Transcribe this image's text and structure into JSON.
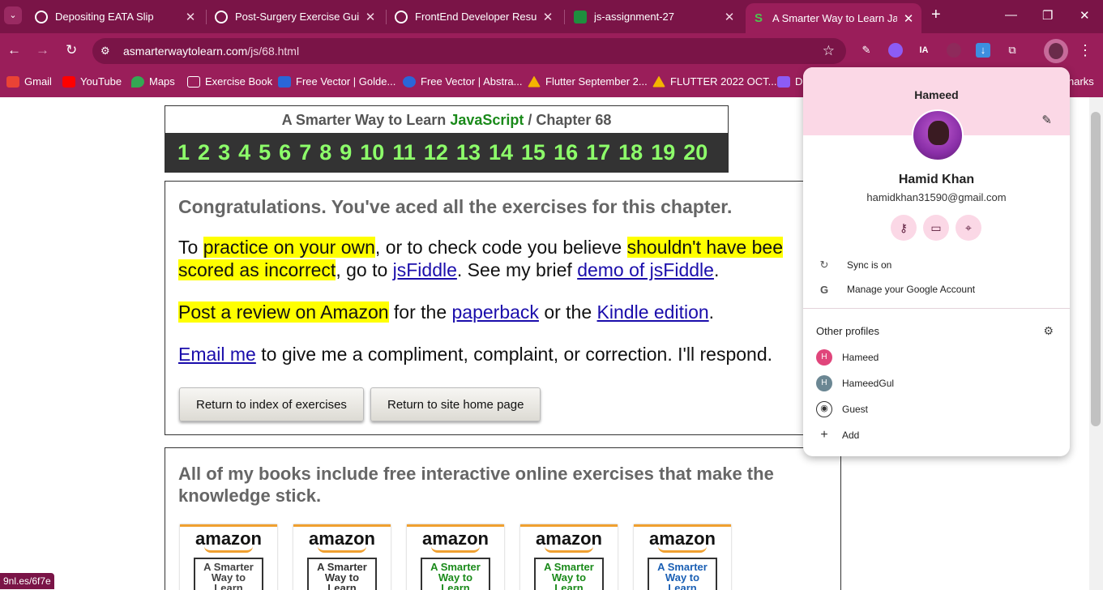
{
  "tabs": [
    {
      "title": "Depositing EATA Slip",
      "icon": "chatgpt-icon"
    },
    {
      "title": "Post-Surgery Exercise Guide",
      "icon": "chatgpt-icon"
    },
    {
      "title": "FrontEnd Developer Resume",
      "icon": "chatgpt-icon"
    },
    {
      "title": "js-assignment-27",
      "icon": "classroom-icon"
    },
    {
      "title": "A Smarter Way to Learn Java",
      "icon": "smarter-way-icon"
    }
  ],
  "window_controls": {
    "new_tab": "+",
    "minimize": "—",
    "restore": "❐",
    "close": "✕"
  },
  "omnibox": {
    "url_host": "asmarterwaytolearn.com",
    "url_path": "/js/68.html"
  },
  "bookmarks": [
    {
      "label": "Gmail"
    },
    {
      "label": "YouTube"
    },
    {
      "label": "Maps"
    },
    {
      "label": "Exercise Book"
    },
    {
      "label": "Free Vector | Golde..."
    },
    {
      "label": "Free Vector | Abstra..."
    },
    {
      "label": "Flutter September 2..."
    },
    {
      "label": "FLUTTER 2022 OCT..."
    },
    {
      "label": "D"
    },
    {
      "label": "narks"
    }
  ],
  "chapter": {
    "prefix": "A Smarter Way to Learn ",
    "highlight": "JavaScript",
    "suffix": "  /  Chapter 68",
    "numbers": [
      "1",
      "2",
      "3",
      "4",
      "5",
      "6",
      "7",
      "8",
      "9",
      "10",
      "11",
      "12",
      "13",
      "14",
      "15",
      "16",
      "17",
      "18",
      "19",
      "20"
    ]
  },
  "congrats": {
    "heading": "Congratulations. You've aced all the exercises for this chapter.",
    "p1": {
      "t1": "To ",
      "hl1": "practice on your own",
      "t2": ", or to check code you believe ",
      "hl2": "shouldn't have bee",
      "hl3": "scored as incorrect",
      "t3": ", go to ",
      "link1": "jsFiddle",
      "t4": ". See my brief ",
      "link2": "demo of jsFiddle",
      "t5": "."
    },
    "p2": {
      "hl": "Post a review on Amazon",
      "t1": " for the ",
      "link1": "paperback",
      "t2": " or the ",
      "link2": "Kindle edition",
      "t3": "."
    },
    "p3": {
      "link": "Email me",
      "t1": " to give me a compliment, complaint, or correction. I'll respond."
    },
    "btn_index": "Return to index of exercises",
    "btn_home": "Return to site home page"
  },
  "books": {
    "heading_l1": " All of my books include free interactive online exercises that make the",
    "heading_l2": "knowledge stick.",
    "logo": "amazon",
    "covers": [
      {
        "l1": "A Smarter",
        "l2": "Way to",
        "l3": "Learn",
        "color": "#444444"
      },
      {
        "l1": "A Smarter",
        "l2": "Way to",
        "l3": "Learn",
        "color": "#333333"
      },
      {
        "l1": "A Smarter",
        "l2": "Way to",
        "l3": "Learn",
        "color": "#1a8a1a"
      },
      {
        "l1": "A Smarter",
        "l2": "Way to",
        "l3": "Learn",
        "color": "#1a8a1a"
      },
      {
        "l1": "A Smarter",
        "l2": "Way to",
        "l3": "Learn",
        "color": "#1a5fb4"
      }
    ]
  },
  "status_bar": "9nl.es/6f7e",
  "profile": {
    "header_name": "Hameed",
    "full_name": "Hamid Khan",
    "email": "hamidkhan31590@gmail.com",
    "sync": "Sync is on",
    "manage": "Manage your Google Account",
    "other_profiles_heading": "Other profiles",
    "others": [
      {
        "initial": "H",
        "name": "Hameed",
        "color": "#e0457b"
      },
      {
        "initial": "H",
        "name": "HameedGul",
        "color": "#6b8793"
      },
      {
        "initial": "",
        "name": "Guest",
        "color": "#ffffff"
      },
      {
        "initial": "",
        "name": "Add",
        "color": "#ffffff"
      }
    ]
  },
  "colors": {
    "chrome_frame": "#7a1447",
    "chrome_toolbar": "#9a1e5a",
    "highlight": "#ffff00",
    "link": "#1a0dab",
    "chapter_numbers": "#8dff6a"
  }
}
